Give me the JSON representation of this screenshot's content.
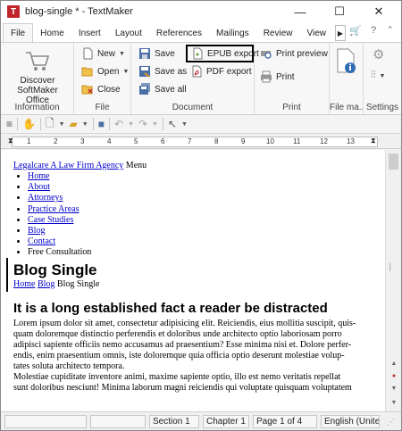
{
  "window": {
    "title": "blog-single * - TextMaker",
    "app_icon": "T",
    "controls": {
      "minimize": "—",
      "maximize": "☐",
      "close": "✕"
    }
  },
  "tabs": [
    "File",
    "Home",
    "Insert",
    "Layout",
    "References",
    "Mailings",
    "Review",
    "View"
  ],
  "active_tab": "File",
  "ribbon": {
    "information": {
      "label": "Information",
      "discover": "Discover\nSoftMaker Office",
      "discover_line1": "Discover",
      "discover_line2": "SoftMaker Office"
    },
    "file": {
      "label": "File",
      "new": "New",
      "open": "Open",
      "close": "Close"
    },
    "document": {
      "label": "Document",
      "save": "Save",
      "save_as": "Save as",
      "save_all": "Save all",
      "epub_export": "EPUB export",
      "pdf_export": "PDF export"
    },
    "print": {
      "label": "Print",
      "print_preview": "Print preview",
      "print": "Print"
    },
    "file_manager": {
      "label": "File ma..."
    },
    "settings": {
      "label": "Settings"
    }
  },
  "ruler": {
    "numbers": [
      "1",
      "2",
      "3",
      "4",
      "5",
      "6",
      "7",
      "8",
      "9",
      "10",
      "11",
      "12",
      "13"
    ]
  },
  "document": {
    "header_link": "Legalcare A Law Firm Agency",
    "header_menu": "Menu",
    "nav": [
      {
        "text": "Home",
        "link": true
      },
      {
        "text": "About",
        "link": true
      },
      {
        "text": "Attorneys",
        "link": true
      },
      {
        "text": "Practice Areas",
        "link": true
      },
      {
        "text": "Case Studies",
        "link": true
      },
      {
        "text": "Blog",
        "link": true
      },
      {
        "text": "Contact",
        "link": true
      },
      {
        "text": "Free Consultation",
        "link": false
      }
    ],
    "heading1": "Blog Single",
    "breadcrumb_home": "Home",
    "breadcrumb_blog": "Blog",
    "breadcrumb_current": "Blog Single",
    "heading2": "It is a long established fact a reader be distracted",
    "para1_lines": [
      "Lorem ipsum dolor sit amet, consectetur adipisicing elit. Reiciendis, eius mollitia suscipit, quis-",
      "quam doloremque distinctio perferendis et doloribus unde architecto optio laboriosam porro",
      "adipisci sapiente officiis nemo accusamus ad praesentium? Esse minima nisi et. Dolore perfer-",
      "endis, enim praesentium omnis, iste doloremque quia officia optio deserunt molestiae volup-",
      "tates soluta architecto tempora."
    ],
    "para2_lines": [
      "Molestiae cupiditate inventore animi, maxime sapiente optio, illo est nemo veritatis repellat",
      "sunt doloribus nesciunt! Minima laborum magni reiciendis qui voluptate quisquam voluptatem"
    ]
  },
  "status": {
    "section": "Section 1",
    "chapter": "Chapter 1",
    "page": "Page 1 of 4",
    "language": "English (United"
  },
  "colors": {
    "app_red": "#c0262d",
    "link_blue": "#0000cc",
    "highlight_border": "#000000"
  }
}
